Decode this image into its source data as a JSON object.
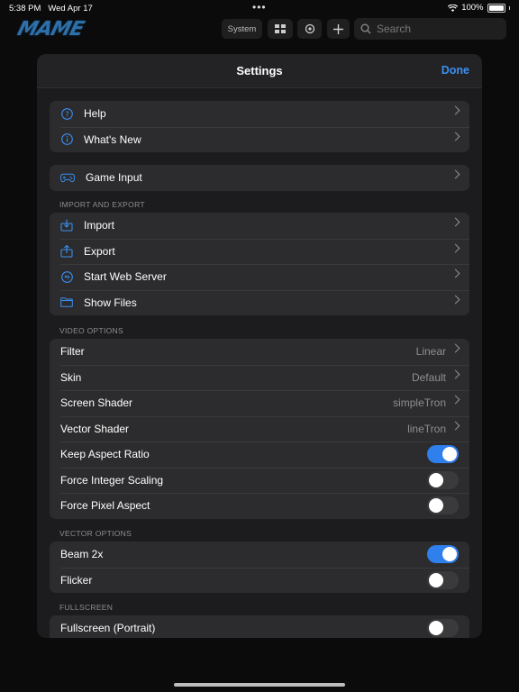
{
  "status_bar": {
    "time": "5:38 PM",
    "date": "Wed Apr 17",
    "battery": "100%"
  },
  "app": {
    "logo_text": "MAME",
    "system_button": "System",
    "search_placeholder": "Search"
  },
  "settings": {
    "title": "Settings",
    "done": "Done",
    "group_help": [
      {
        "label": "Help",
        "icon": "question-icon"
      },
      {
        "label": "What's New",
        "icon": "info-icon"
      }
    ],
    "group_input": [
      {
        "label": "Game Input",
        "icon": "gamecontroller-icon"
      }
    ],
    "import_export": {
      "header": "IMPORT AND EXPORT",
      "items": [
        {
          "label": "Import",
          "icon": "import-icon"
        },
        {
          "label": "Export",
          "icon": "export-icon"
        },
        {
          "label": "Start Web Server",
          "icon": "server-icon"
        },
        {
          "label": "Show Files",
          "icon": "folder-icon"
        }
      ]
    },
    "video": {
      "header": "VIDEO OPTIONS",
      "filter": {
        "label": "Filter",
        "value": "Linear"
      },
      "skin": {
        "label": "Skin",
        "value": "Default"
      },
      "screen_shader": {
        "label": "Screen Shader",
        "value": "simpleTron"
      },
      "vector_shader": {
        "label": "Vector Shader",
        "value": "lineTron"
      },
      "keep_aspect": {
        "label": "Keep Aspect Ratio",
        "on": true
      },
      "integer_scaling": {
        "label": "Force Integer Scaling",
        "on": false
      },
      "pixel_aspect": {
        "label": "Force Pixel Aspect",
        "on": false
      }
    },
    "vector": {
      "header": "VECTOR OPTIONS",
      "beam": {
        "label": "Beam 2x",
        "on": true
      },
      "flicker": {
        "label": "Flicker",
        "on": false
      }
    },
    "fullscreen": {
      "header": "FULLSCREEN",
      "portrait": {
        "label": "Fullscreen (Portrait)",
        "on": false
      }
    }
  },
  "colors": {
    "accent": "#3a8ff0",
    "toggle_on": "#2f80ed",
    "sheet_bg": "#1c1c1e",
    "row_bg": "#2c2c2e"
  }
}
